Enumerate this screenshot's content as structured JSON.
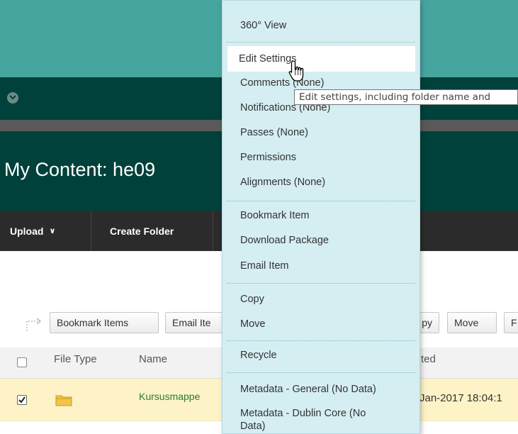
{
  "header": {
    "page_title": "My Content: he09"
  },
  "nav": {
    "upload_label": "Upload",
    "upload_chevron": "∨",
    "create_folder_label": "Create Folder"
  },
  "action_bar": {
    "buttons": [
      "Bookmark Items",
      "Email Ite",
      "py",
      "Move",
      "F"
    ]
  },
  "table": {
    "columns": [
      "File Type",
      "Name",
      "ted"
    ],
    "rows": [
      {
        "checked": true,
        "name": "Kursusmappe",
        "date": "Jan-2017 18:04:1"
      }
    ]
  },
  "menu": {
    "items": [
      "360° View",
      "Edit Settings",
      "Comments (None)",
      "Notifications (None)",
      "Passes (None)",
      "Permissions",
      "Alignments (None)",
      "Bookmark Item",
      "Download Package",
      "Email Item",
      "Copy",
      "Move",
      "Recycle",
      "Metadata - General (No Data)",
      "Metadata - Dublin Core (No",
      "Data)"
    ],
    "highlighted": "Edit Settings"
  },
  "tooltip": {
    "text": "Edit settings, including folder name and"
  },
  "colors": {
    "header_teal": "#47a59f",
    "header_dark": "#00413b",
    "nav_bar": "#2b2b2b",
    "menu_bg": "#d5eef2",
    "selected_row": "#fdf3c6",
    "link_green": "#2e7a34"
  }
}
